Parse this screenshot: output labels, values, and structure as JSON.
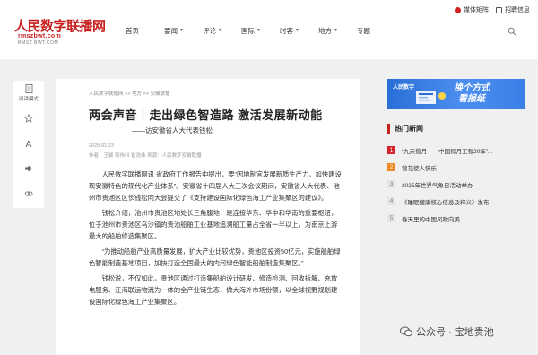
{
  "header": {
    "logo_main": "人民数字联播网",
    "logo_url": "rmszbwt.com",
    "logo_sub": "RMSZ BWT.COM",
    "top_links": [
      "媒体矩阵",
      "招聘信息"
    ],
    "nav": [
      {
        "label": "首页",
        "chevron": false
      },
      {
        "label": "要闻",
        "chevron": true
      },
      {
        "label": "评论",
        "chevron": true
      },
      {
        "label": "国际",
        "chevron": true
      },
      {
        "label": "时客",
        "chevron": true
      },
      {
        "label": "地方",
        "chevron": true
      },
      {
        "label": "专题",
        "chevron": false
      }
    ]
  },
  "toolbar": [
    {
      "icon": "document-icon",
      "label": "阅读模式"
    },
    {
      "icon": "star-icon",
      "label": ""
    },
    {
      "icon": "font-size-icon",
      "label": ""
    },
    {
      "icon": "sound-icon",
      "label": ""
    },
    {
      "icon": "share-icon",
      "label": ""
    }
  ],
  "article": {
    "breadcrumb": "人民数字联播网 >> 地方 >> 安徽联播",
    "title": "两会声音｜走出绿色智造路 激活发展新动能",
    "subtitle": "——访安徽省人大代表钱松",
    "date": "2025-01-23",
    "meta": "作者：王颖 邹伟科 崔浩伟    来源：人民数字安徽联播",
    "paragraphs": [
      "人民数字联播网讯 省政府工作报告中提出，要“因地制宜发展新质生产力，加快建设现安徽特色的现代化产业体系”。安徽省十四届人大三次会议期间，安徽省人大代表、池州市贵池区区长钱松向大会提交了《支持建设国际化绿色海工产业集聚区的建议》。",
      "钱松介绍，池州市贵池区地处长三角腹地，是连接华东、华中和华南的重要枢纽，位于池州市贵池区乌沙镇的贵池船舶工业基地追溯船工量占全省一半以上，为南京上游最大的船舶修造集聚区。",
      "“为推动船舶产业高质量发展，扩大产业比较优势，贵池区投资50亿元，实施船舶绿色智能制造基地项目，加快打造全国最大的内河绿色智能船舶制造集聚区。”",
      "钱松说，不仅如此，贵池区通过打造集船舶设计研发、修造检测、回收拆解、充放电服务、江海联运物流为一体的全产业链生态，做大海外市场份额，以全球视野规划建设国际化绿色海工产业集聚区。"
    ]
  },
  "banner": {
    "logo": "人民数字",
    "line1": "换个方式",
    "line2": "看报纸"
  },
  "hot": {
    "title": "热门新闻",
    "items": [
      {
        "rank": "1",
        "style": "red",
        "text": "“九天揽月——中国探月工程20年”..."
      },
      {
        "rank": "2",
        "style": "orange",
        "text": "营花使人快乐"
      },
      {
        "rank": "3",
        "style": "gray",
        "text": "2025年世界气象日活动举办"
      },
      {
        "rank": "4",
        "style": "gray",
        "text": "《睡眠健康核心信息及释义》发布"
      },
      {
        "rank": "5",
        "style": "gray",
        "text": "春天里的中国风吹向美"
      }
    ]
  },
  "watermark": "公众号 · 宝地贵池",
  "colors": {
    "brand_red": "#c81f1f",
    "banner_blue": "#2a6fd6",
    "rank_orange": "#f08a24"
  }
}
